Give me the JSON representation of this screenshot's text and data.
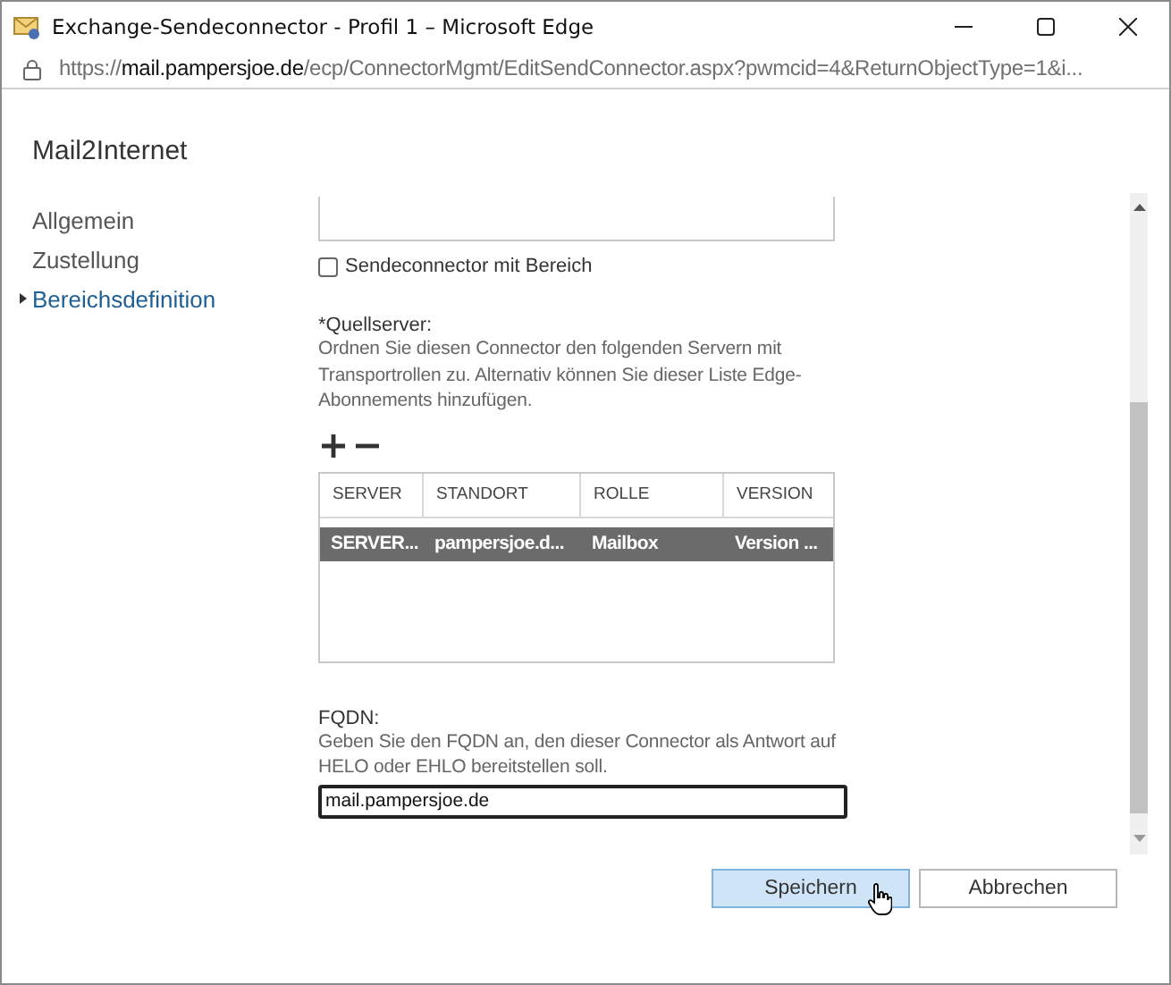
{
  "window": {
    "title": "Exchange-Sendeconnector - Profil 1 – Microsoft Edge"
  },
  "address": {
    "scheme": "https://",
    "host": "mail.pampersjoe.de",
    "path": "/ecp/ConnectorMgmt/EditSendConnector.aspx?pwmcid=4&ReturnObjectType=1&i..."
  },
  "heading": "Mail2Internet",
  "nav": [
    {
      "label": "Allgemein",
      "selected": false
    },
    {
      "label": "Zustellung",
      "selected": false
    },
    {
      "label": "Bereichsdefinition",
      "selected": true
    }
  ],
  "scoped": {
    "label": "Sendeconnector mit Bereich",
    "checked": false
  },
  "source": {
    "label": "*Quellserver:",
    "description": "Ordnen Sie diesen Connector den folgenden Servern mit Transportrollen zu. Alternativ können Sie dieser Liste Edge-Abonnements hinzufügen."
  },
  "table": {
    "columns": [
      "SERVER",
      "STANDORT",
      "ROLLE",
      "VERSION"
    ],
    "rows": [
      {
        "cells": [
          "SERVER...",
          "pampersjoe.d...",
          "Mailbox",
          "Version ..."
        ],
        "selected": true
      }
    ]
  },
  "fqdn": {
    "label": "FQDN:",
    "description": "Geben Sie den FQDN an, den dieser Connector als Antwort auf HELO oder EHLO bereitstellen soll.",
    "value": "mail.pampersjoe.de"
  },
  "buttons": [
    {
      "label": "Speichern",
      "hovered": true
    },
    {
      "label": "Abbrechen",
      "hovered": false
    }
  ]
}
